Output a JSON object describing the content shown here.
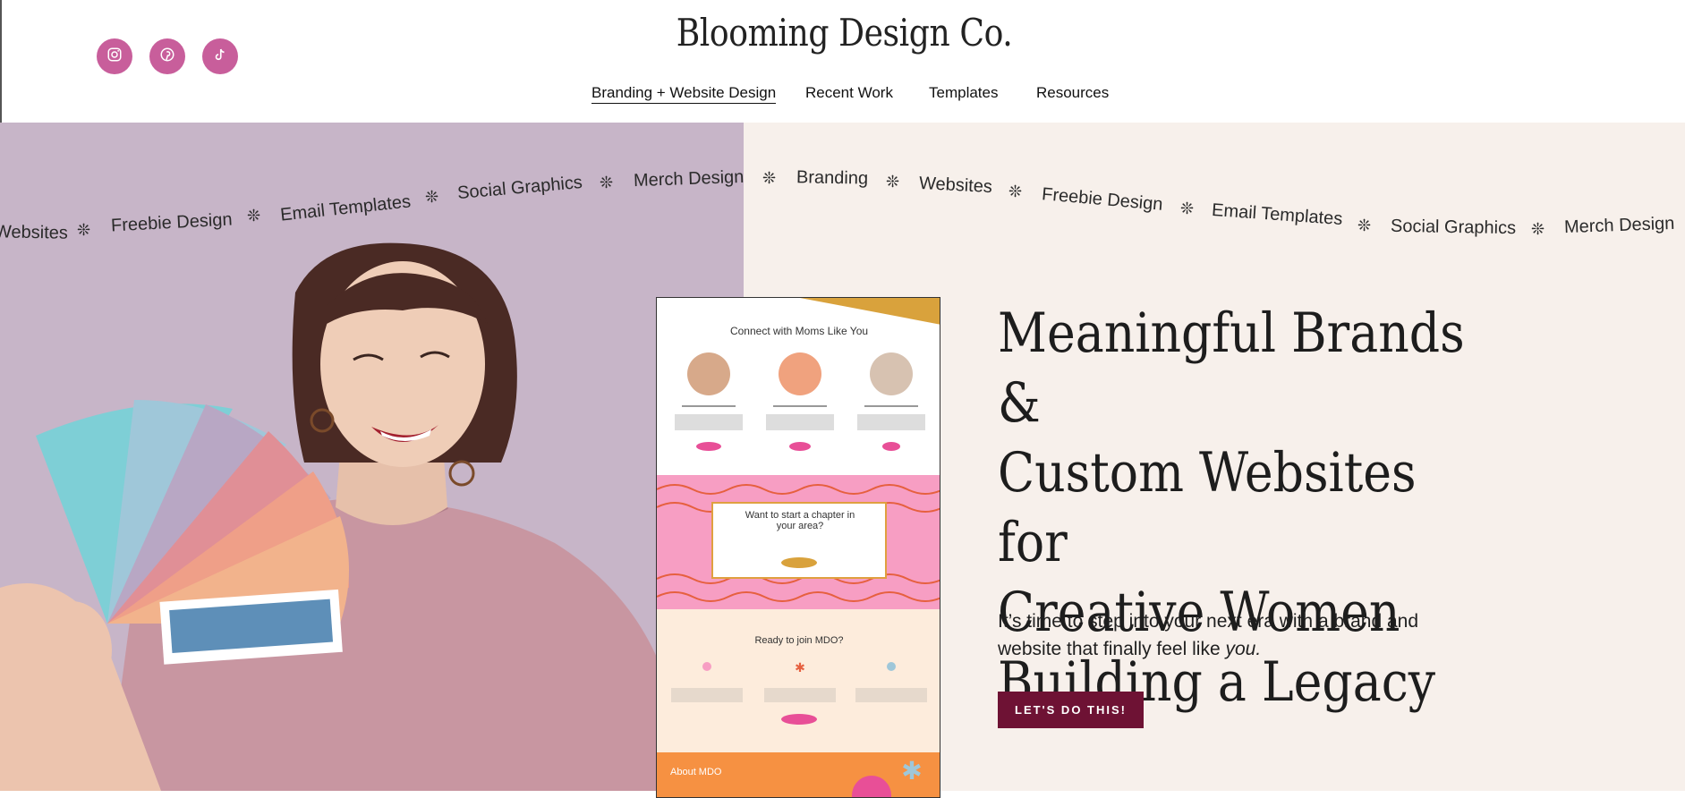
{
  "header": {
    "brand": "Blooming Design Co.",
    "social": [
      {
        "icon": "instagram-icon"
      },
      {
        "icon": "pinterest-icon"
      },
      {
        "icon": "tiktok-icon"
      }
    ],
    "nav": [
      {
        "label": "Branding + Website Design",
        "active": true
      },
      {
        "label": "Recent Work"
      },
      {
        "label": "Templates"
      },
      {
        "label": "Resources"
      }
    ]
  },
  "ticker": [
    "Websites",
    "Freebie Design",
    "Email Templates",
    "Social Graphics",
    "Merch Design",
    "Branding",
    "Websites",
    "Freebie Design",
    "Email Templates",
    "Social Graphics",
    "Merch Design"
  ],
  "hero": {
    "headline": [
      "Meaningful Brands &",
      "Custom Websites for",
      "Creative Women",
      "Building a Legacy"
    ],
    "subtext_main": "It’s time to step into your next era with a brand and website that finally feel like ",
    "subtext_em": "you.",
    "cta": "LET'S DO THIS!"
  },
  "mockup": {
    "title": "Connect with Moms Like You",
    "card2": "Want to start a chapter in your area?",
    "section3": "Ready to join MDO?",
    "section4": "About MDO"
  },
  "colors": {
    "accent": "#c85e9b",
    "cta": "#6e1234",
    "hero_left": "#c9b7c9",
    "hero_right": "#f7f0eb"
  }
}
